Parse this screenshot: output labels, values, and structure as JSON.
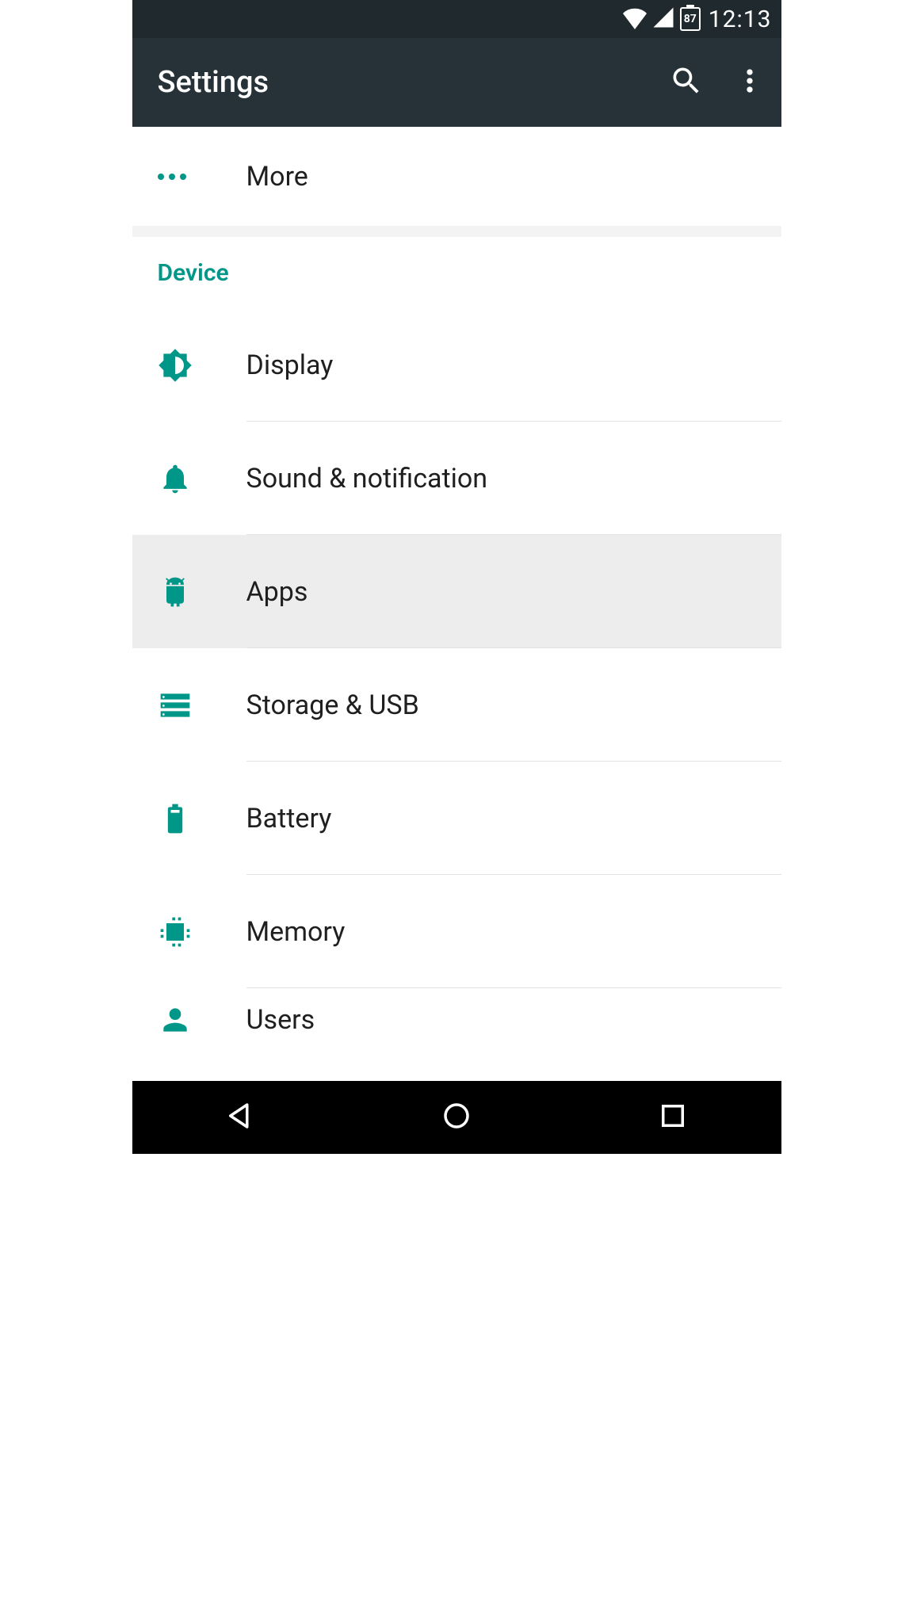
{
  "statusbar": {
    "battery": "87",
    "time": "12:13"
  },
  "appbar": {
    "title": "Settings"
  },
  "top_row": {
    "label": "More"
  },
  "section": {
    "header": "Device"
  },
  "items": [
    {
      "label": "Display"
    },
    {
      "label": "Sound & notification"
    },
    {
      "label": "Apps"
    },
    {
      "label": "Storage & USB"
    },
    {
      "label": "Battery"
    },
    {
      "label": "Memory"
    },
    {
      "label": "Users"
    }
  ]
}
